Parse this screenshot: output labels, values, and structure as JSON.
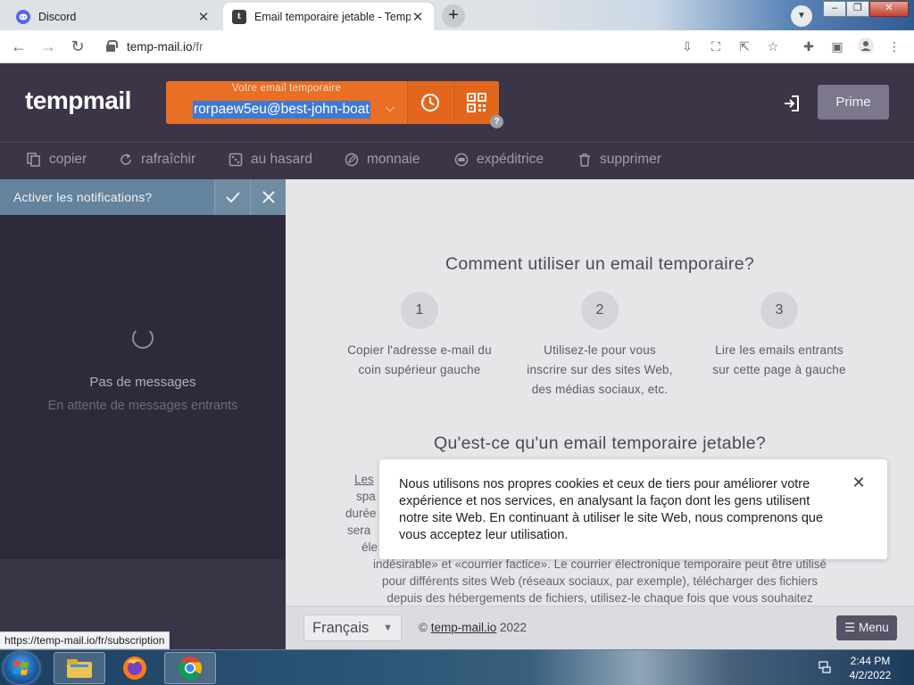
{
  "browser": {
    "tabs": [
      {
        "title": "Discord",
        "favicon": "discord-icon"
      },
      {
        "title": "Email temporaire jetable - Temp Mail",
        "favicon": "tempmail-icon",
        "favicon_letter": "t"
      }
    ],
    "url_domain": "temp-mail.io",
    "url_path": "/fr",
    "status_url": "https://temp-mail.io/fr/subscription"
  },
  "header": {
    "logo": "tempmail",
    "email_label": "Votre email temporaire",
    "email_value": "rorpaew5eu@best-john-boat",
    "help": "?",
    "prime_label": "Prime"
  },
  "actions": {
    "copy": "copier",
    "refresh": "rafraîchir",
    "random": "au hasard",
    "change": "monnaie",
    "sender": "expéditrice",
    "delete": "supprimer"
  },
  "sidebar": {
    "notification_prompt": "Activer les notifications?",
    "empty_title": "Pas de messages",
    "empty_subtitle": "En attente de messages entrants"
  },
  "main": {
    "how_title": "Comment utiliser un email temporaire?",
    "steps": [
      {
        "num": "1",
        "line1": "Copier l'adresse e-mail du",
        "line2": "coin supérieur gauche",
        "line3": ""
      },
      {
        "num": "2",
        "line1": "Utilisez-le pour vous",
        "line2": "inscrire sur des sites Web,",
        "line3": "des médias sociaux, etc."
      },
      {
        "num": "3",
        "line1": "Lire les emails entrants",
        "line2": "sur cette page à gauche",
        "line3": ""
      }
    ],
    "what_title": "Qu'est-ce qu'un email temporaire jetable?",
    "para_fragments": [
      "Les",
      "spa",
      "durée",
      "sera",
      "éle"
    ],
    "para_lines": [
      "indésirable» et «courrier factice». Le courrier électronique temporaire peut être utilisé",
      "pour différents sites Web (réseaux sociaux, par exemple), télécharger des fichiers",
      "depuis des hébergements de fichiers, utilisez-le chaque fois que vous souhaitez"
    ]
  },
  "cookie": {
    "text": "Nous utilisons nos propres cookies et ceux de tiers pour améliorer votre expérience et nos services, en analysant la façon dont les gens utilisent notre site Web. En continuant à utiliser le site Web, nous comprenons que vous acceptez leur utilisation."
  },
  "footer": {
    "language": "Français",
    "copyright_prefix": "©",
    "copyright_link": "temp-mail.io",
    "copyright_year": "2022",
    "menu_label": "Menu"
  },
  "taskbar": {
    "time": "2:44 PM",
    "date": "4/2/2022"
  },
  "colors": {
    "header_bg": "#3c3548",
    "accent_orange": "#e86f24",
    "sidebar_bg": "#2f2a3b",
    "notification_bg": "#64839c",
    "main_bg": "#e6e5e8"
  }
}
